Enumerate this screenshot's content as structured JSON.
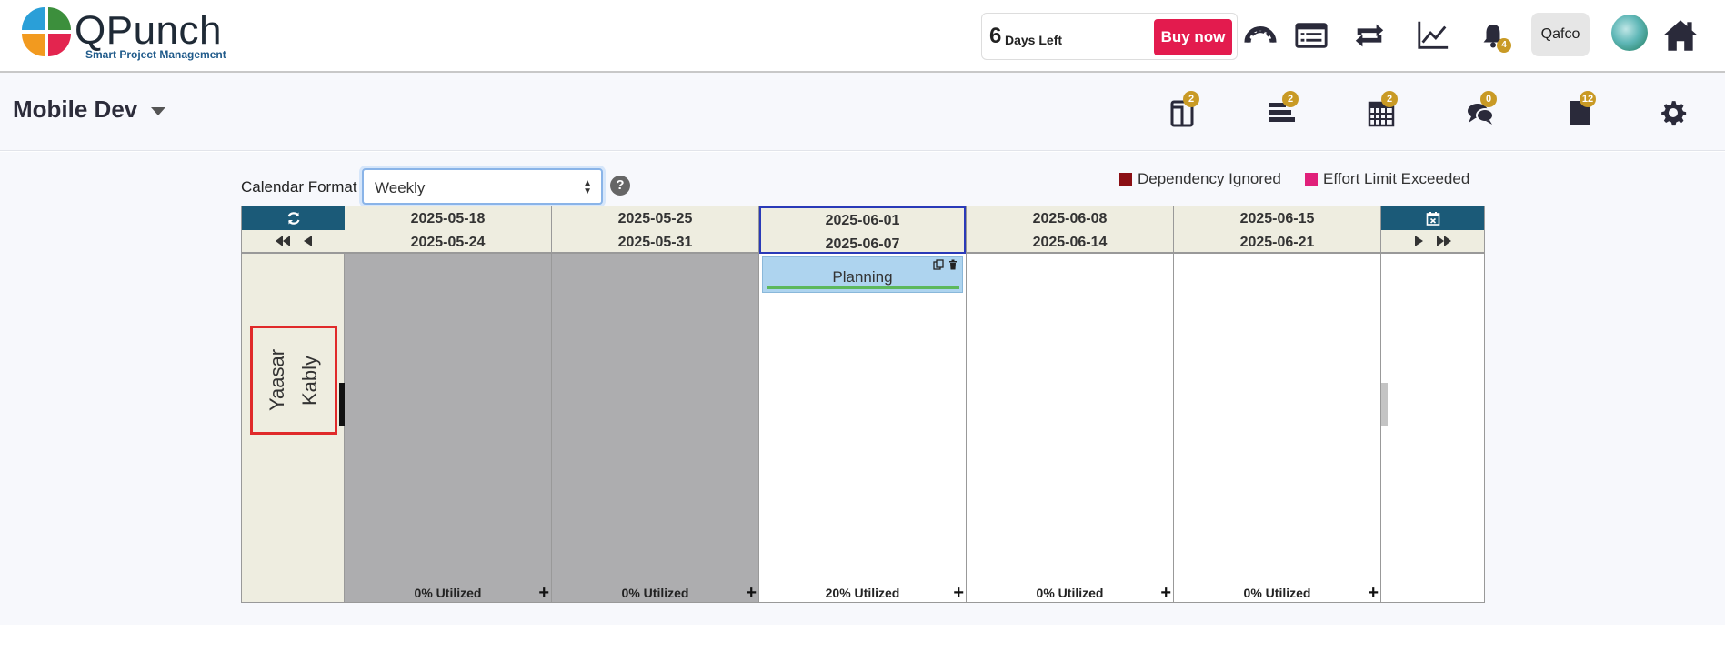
{
  "header": {
    "logo_text": "QPunch",
    "logo_tagline": "Smart Project Management",
    "trial_days": "6",
    "trial_label": "Days Left",
    "buy_label": "Buy now",
    "notifications_count": "4",
    "user_label": "Qafco",
    "icons": [
      "dashboard-icon",
      "list-icon",
      "sync-icon",
      "chart-line-icon",
      "bell-icon",
      "globe-avatar",
      "home-icon"
    ]
  },
  "project": {
    "name": "Mobile Dev",
    "tools": [
      {
        "name": "boards-icon",
        "count": "2"
      },
      {
        "name": "gantt-icon",
        "count": "2"
      },
      {
        "name": "calendar-icon",
        "count": "2"
      },
      {
        "name": "chat-icon",
        "count": "0"
      },
      {
        "name": "file-icon",
        "count": "12"
      },
      {
        "name": "gear-icon",
        "count": ""
      }
    ]
  },
  "calendar": {
    "format_label": "Calendar Format",
    "format_value": "Weekly",
    "legend": [
      {
        "label": "Dependency Ignored",
        "color": "#8b0f14"
      },
      {
        "label": "Effort Limit Exceeded",
        "color": "#e0207a"
      }
    ],
    "resource": "Yaasar Kably",
    "weeks": [
      {
        "start": "2025-05-18",
        "end": "2025-05-24",
        "utilization": "0% Utilized",
        "past": true,
        "selected": false
      },
      {
        "start": "2025-05-25",
        "end": "2025-05-31",
        "utilization": "0% Utilized",
        "past": true,
        "selected": false
      },
      {
        "start": "2025-06-01",
        "end": "2025-06-07",
        "utilization": "20% Utilized",
        "past": false,
        "selected": true
      },
      {
        "start": "2025-06-08",
        "end": "2025-06-14",
        "utilization": "0% Utilized",
        "past": false,
        "selected": false
      },
      {
        "start": "2025-06-15",
        "end": "2025-06-21",
        "utilization": "0% Utilized",
        "past": false,
        "selected": false
      }
    ],
    "task": {
      "label": "Planning",
      "week_index": 2
    }
  },
  "colors": {
    "accent": "#1b5a78",
    "buy": "#e31b4e",
    "badge": "#c99a25",
    "past_week": "#adadaf",
    "task": "#aed4ef"
  }
}
